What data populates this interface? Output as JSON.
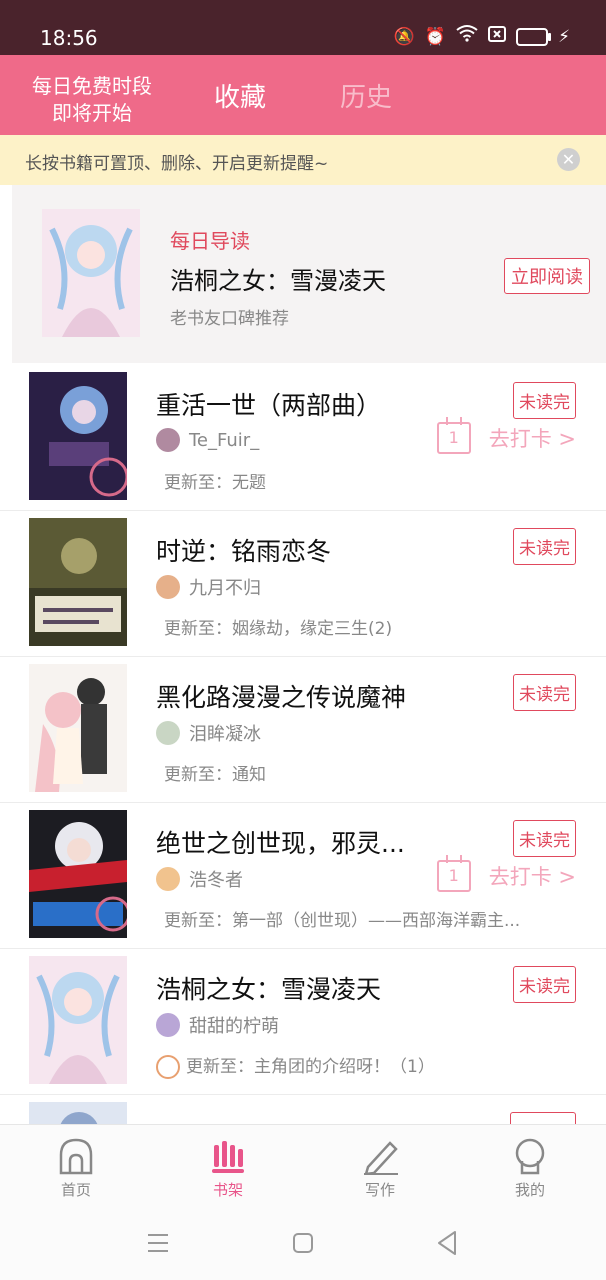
{
  "status_bar": {
    "time": "18:56"
  },
  "header": {
    "free_line1": "每日免费时段",
    "free_line2": "即将开始",
    "tab_favorites": "收藏",
    "tab_history": "历史"
  },
  "notice": {
    "text": "长按书籍可置顶、删除、开启更新提醒~"
  },
  "featured": {
    "label": "每日导读",
    "title": "浩桐之女：雪漫凌天",
    "subtitle": "老书友口碑推荐",
    "button": "立即阅读"
  },
  "books": [
    {
      "title": "重活一世（两部曲）",
      "author": "Te_Fuir_",
      "update": "更新至：无题",
      "badge": "未读完",
      "checkin": "去打卡 >",
      "calendar_day": "1"
    },
    {
      "title": "时逆：铭雨恋冬",
      "author": "九月不归",
      "update": "更新至：姻缘劫，缘定三生(2)",
      "badge": "未读完"
    },
    {
      "title": "黑化路漫漫之传说魔神",
      "author": "泪眸凝冰",
      "update": "更新至：通知",
      "badge": "未读完"
    },
    {
      "title": "绝世之创世现，邪灵...",
      "author": "浩冬者",
      "update": "更新至：第一部（创世现）——西部海洋霸主...",
      "badge": "未读完",
      "checkin": "去打卡 >",
      "calendar_day": "1"
    },
    {
      "title": "浩桐之女：雪漫凌天",
      "author": "甜甜的柠萌",
      "update": "更新至：主角团的介绍呀！（1）",
      "badge": "未读完"
    }
  ],
  "tabbar": {
    "home": "首页",
    "bookshelf": "书架",
    "write": "写作",
    "mine": "我的"
  },
  "colors": {
    "accent": "#ef6a89",
    "status_bar": "#4a232c",
    "badge_red": "#e0495d",
    "checkin_pink": "#f3a6bb"
  }
}
